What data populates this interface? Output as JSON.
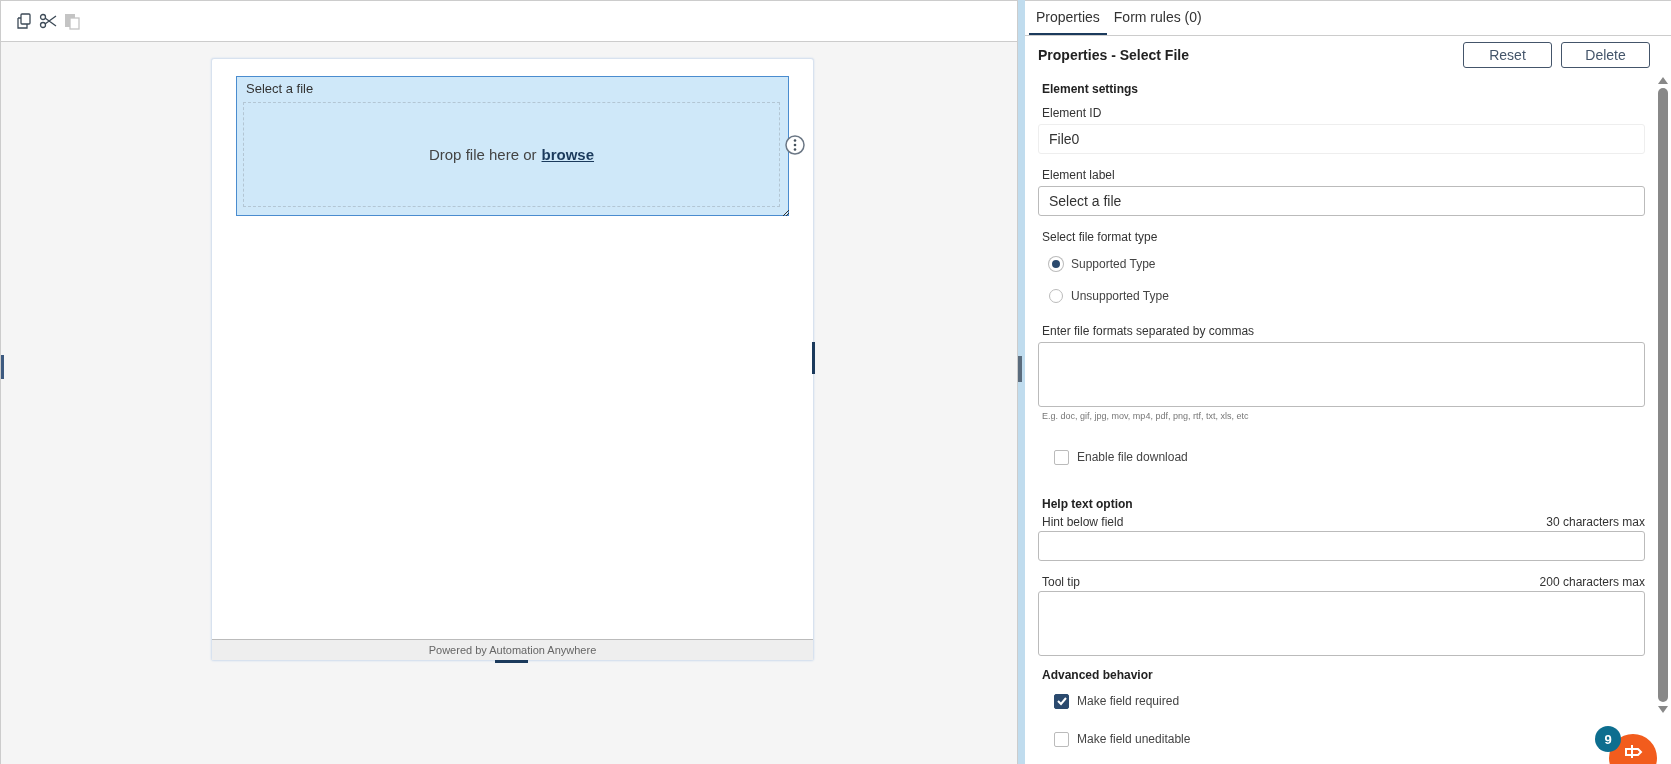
{
  "toolbar": [
    {
      "kind": "copy",
      "disabled": false
    },
    {
      "kind": "cut",
      "disabled": false
    },
    {
      "kind": "paste",
      "disabled": true
    }
  ],
  "canvas": {
    "file_element": {
      "label": "Select a file",
      "drop_text": "Drop file here or",
      "browse_link": "browse",
      "selected": true
    },
    "footer": "Powered by Automation Anywhere"
  },
  "panel": {
    "tabs": [
      {
        "label": "Properties",
        "selected": true
      },
      {
        "label": "Form rules (0)",
        "selected": false
      }
    ],
    "title": "Properties - Select File",
    "buttons": [
      "Reset",
      "Delete"
    ],
    "element_settings": {
      "heading": "Element settings",
      "element_id": {
        "label": "Element ID",
        "value": "File0",
        "readonly": true
      },
      "element_label": {
        "label": "Element label",
        "value": "Select a file",
        "readonly": false
      },
      "format_type": {
        "label": "Select file format type",
        "options": [
          {
            "label": "Supported Type",
            "selected": true
          },
          {
            "label": "Unsupported Type",
            "selected": false
          }
        ]
      },
      "formats": {
        "label": "Enter file formats separated by commas",
        "hint": "E.g. doc, gif, jpg, mov, mp4, pdf, png, rtf, txt, xls, etc"
      },
      "download": {
        "label": "Enable file download",
        "checked": false
      }
    },
    "help_text": {
      "heading": "Help text option",
      "hint_field": {
        "label": "Hint below field",
        "limit": "30 characters max"
      },
      "tooltip": {
        "label": "Tool tip",
        "limit": "200 characters max"
      }
    },
    "advanced": {
      "heading": "Advanced behavior",
      "options": [
        {
          "label": "Make field required",
          "checked": true
        },
        {
          "label": "Make field uneditable",
          "checked": false
        }
      ]
    }
  },
  "help_badge": "9"
}
